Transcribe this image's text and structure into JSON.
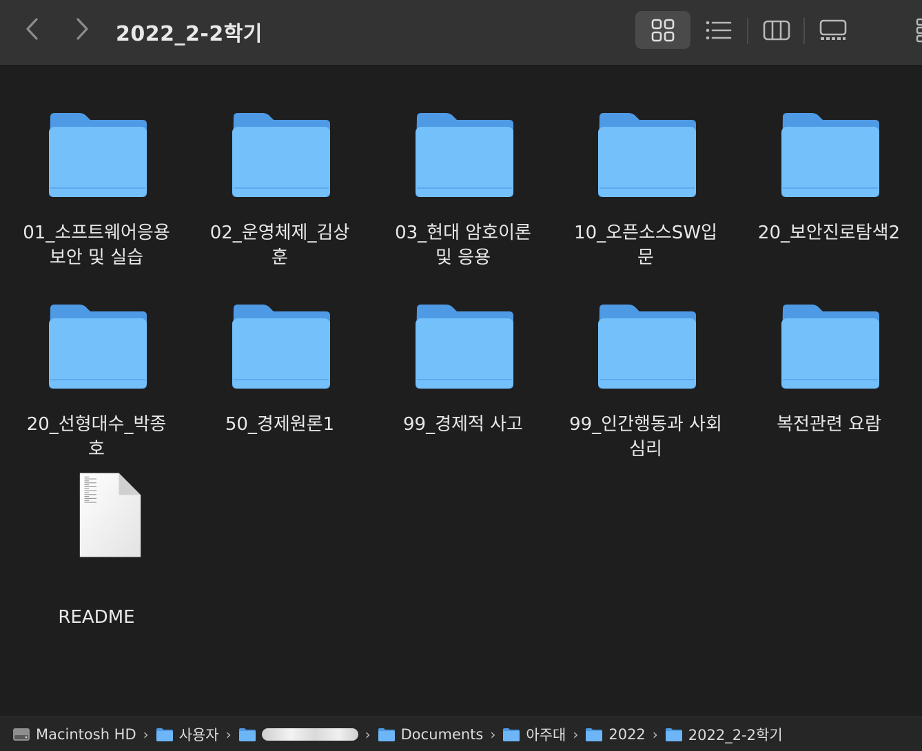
{
  "toolbar": {
    "title": "2022_2-2학기",
    "back_icon": "chevron-left-icon",
    "forward_icon": "chevron-right-icon",
    "views": [
      "icon-view-icon",
      "list-view-icon",
      "column-view-icon",
      "gallery-view-icon"
    ],
    "selected_view": "icon"
  },
  "items": [
    {
      "kind": "folder",
      "label_lines": [
        "01_소프트웨어응용",
        "보안 및 실습"
      ]
    },
    {
      "kind": "folder",
      "label_lines": [
        "02_운영체제_김상",
        "훈"
      ]
    },
    {
      "kind": "folder",
      "label_lines": [
        "03_현대 암호이론",
        "및 응용"
      ]
    },
    {
      "kind": "folder",
      "label_lines": [
        "10_오픈소스SW입",
        "문"
      ]
    },
    {
      "kind": "folder",
      "label_lines": [
        "20_보안진로탐색2"
      ]
    },
    {
      "kind": "folder",
      "label_lines": [
        "20_선형대수_박종",
        "호"
      ]
    },
    {
      "kind": "folder",
      "label_lines": [
        "50_경제원론1"
      ]
    },
    {
      "kind": "folder",
      "label_lines": [
        "99_경제적 사고"
      ]
    },
    {
      "kind": "folder",
      "label_lines": [
        "99_인간행동과 사회",
        "심리"
      ]
    },
    {
      "kind": "folder",
      "label_lines": [
        "복전관련 요람"
      ]
    },
    {
      "kind": "document",
      "label_lines": [
        "README"
      ]
    }
  ],
  "pathbar": {
    "crumbs": [
      {
        "label": "Macintosh HD",
        "icon": "hard-drive-icon"
      },
      {
        "label": "사용자",
        "icon": "users-folder-icon"
      },
      {
        "label": "",
        "icon": "home-folder-icon",
        "redacted": true
      },
      {
        "label": "Documents",
        "icon": "documents-folder-icon"
      },
      {
        "label": "아주대",
        "icon": "folder-icon"
      },
      {
        "label": "2022",
        "icon": "folder-icon"
      },
      {
        "label": "2022_2-2학기",
        "icon": "folder-icon"
      }
    ]
  },
  "colors": {
    "background": "#1e1e1e",
    "toolbar": "#333333",
    "folder_body": "#74c0fb",
    "folder_tab": "#4f9ae5",
    "text": "#e8e8e8"
  }
}
